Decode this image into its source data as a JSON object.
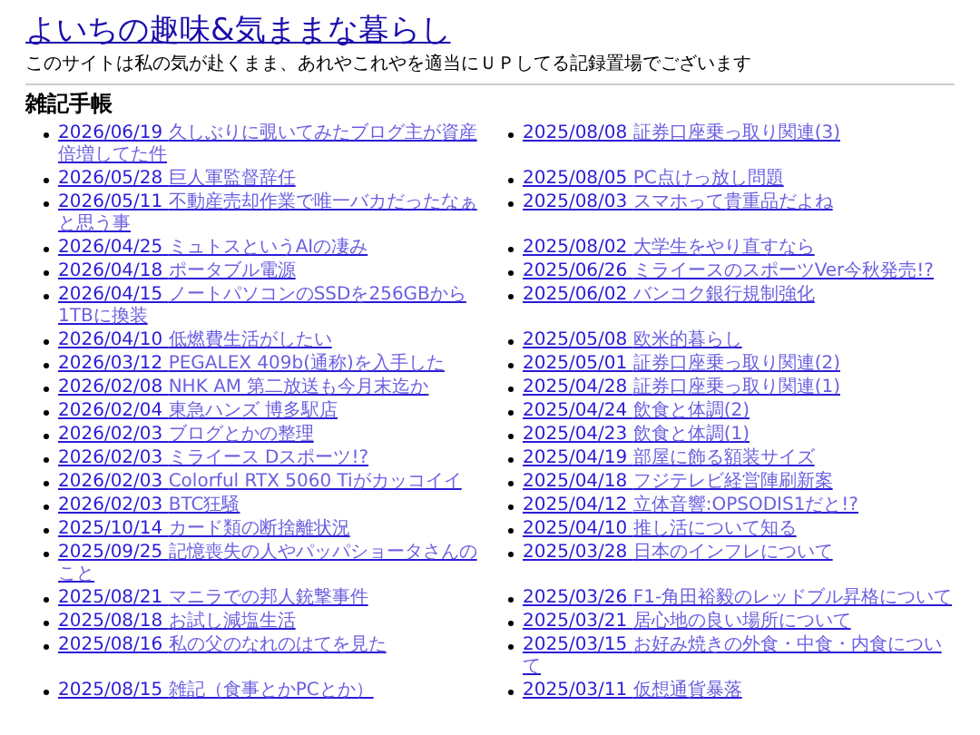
{
  "site": {
    "title": "よいちの趣味&気ままな暮らし",
    "tagline": "このサイトは私の気が赴くまま、あれやこれやを適当にＵＰしてる記録置場でございます"
  },
  "section": {
    "heading": "雑記手帳",
    "posts": [
      {
        "date": "2026/06/19",
        "title": "久しぶりに覗いてみたブログ主が資産倍増してた件"
      },
      {
        "date": "2026/05/28",
        "title": "巨人軍監督辞任"
      },
      {
        "date": "2026/05/11",
        "title": "不動産売却作業で唯一バカだったなぁと思う事"
      },
      {
        "date": "2026/04/25",
        "title": "ミュトスというAIの凄み"
      },
      {
        "date": "2026/04/18",
        "title": "ポータブル電源"
      },
      {
        "date": "2026/04/15",
        "title": "ノートパソコンのSSDを256GBから1TBに換装"
      },
      {
        "date": "2026/04/10",
        "title": "低燃費生活がしたい"
      },
      {
        "date": "2026/03/12",
        "title": "PEGALEX 409b(通称)を入手した"
      },
      {
        "date": "2026/02/08",
        "title": "NHK AM 第二放送も今月末迄か"
      },
      {
        "date": "2026/02/04",
        "title": "東急ハンズ 博多駅店"
      },
      {
        "date": "2026/02/03",
        "title": "ブログとかの整理"
      },
      {
        "date": "2026/02/03",
        "title": "ミライース Dスポーツ!?"
      },
      {
        "date": "2026/02/03",
        "title": "Colorful RTX 5060 Tiがカッコイイ"
      },
      {
        "date": "2026/02/03",
        "title": "BTC狂騒"
      },
      {
        "date": "2025/10/14",
        "title": "カード類の断捨離状況"
      },
      {
        "date": "2025/09/25",
        "title": "記憶喪失の人やパッパショータさんのこと"
      },
      {
        "date": "2025/08/21",
        "title": "マニラでの邦人銃撃事件"
      },
      {
        "date": "2025/08/18",
        "title": "お試し減塩生活"
      },
      {
        "date": "2025/08/16",
        "title": "私の父のなれのはてを見た"
      },
      {
        "date": "2025/08/15",
        "title": "雑記（食事とかPCとか）"
      },
      {
        "date": "2025/08/08",
        "title": "証券口座乗っ取り関連(3)"
      },
      {
        "date": "2025/08/05",
        "title": "PC点けっ放し問題"
      },
      {
        "date": "2025/08/03",
        "title": "スマホって貴重品だよね"
      },
      {
        "date": "2025/08/02",
        "title": "大学生をやり直すなら"
      },
      {
        "date": "2025/06/26",
        "title": "ミライースのスポーツVer今秋発売!?"
      },
      {
        "date": "2025/06/02",
        "title": "バンコク銀行規制強化"
      },
      {
        "date": "2025/05/08",
        "title": "欧米的暮らし"
      },
      {
        "date": "2025/05/01",
        "title": "証券口座乗っ取り関連(2)"
      },
      {
        "date": "2025/04/28",
        "title": "証券口座乗っ取り関連(1)"
      },
      {
        "date": "2025/04/24",
        "title": "飲食と体調(2)"
      },
      {
        "date": "2025/04/23",
        "title": "飲食と体調(1)"
      },
      {
        "date": "2025/04/19",
        "title": "部屋に飾る額装サイズ"
      },
      {
        "date": "2025/04/18",
        "title": "フジテレビ経営陣刷新案"
      },
      {
        "date": "2025/04/12",
        "title": "立体音響:OPSODIS1だと!?"
      },
      {
        "date": "2025/04/10",
        "title": "推し活について知る"
      },
      {
        "date": "2025/03/28",
        "title": "日本のインフレについて"
      },
      {
        "date": "2025/03/26",
        "title": "F1-角田裕毅のレッドブル昇格について"
      },
      {
        "date": "2025/03/21",
        "title": "居心地の良い場所について"
      },
      {
        "date": "2025/03/15",
        "title": "お好み焼きの外食・中食・内食について"
      },
      {
        "date": "2025/03/11",
        "title": "仮想通貨暴落"
      }
    ]
  }
}
